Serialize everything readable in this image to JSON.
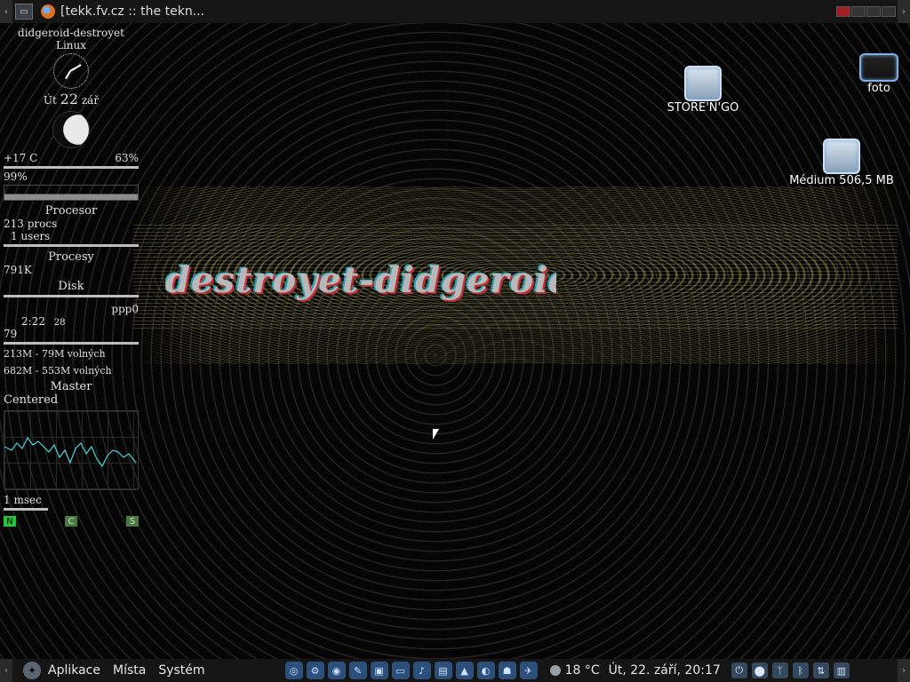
{
  "top_panel": {
    "left_arrow": "‹",
    "right_arrow": "›",
    "window_title": "[tekk.fv.cz :: the tekn...",
    "workspaces": [
      true,
      false,
      false,
      false
    ]
  },
  "conky": {
    "hostname": "didgeroid-destroyet",
    "os": "Linux",
    "date_day_name": "Út",
    "date_day": "22",
    "date_month": "zář",
    "temperature": "+17 C",
    "humidity": "63%",
    "cpu_percent": "99%",
    "processor_heading": "Procesor",
    "procs": "213 procs",
    "users": "1 users",
    "processes_heading": "Procesy",
    "mem_value": "791K",
    "disk_heading": "Disk",
    "net_interface": "ppp0",
    "uptime": "2:22",
    "uptime_extra": "28",
    "net_value": "79",
    "ram_line": "213M - 79M volných",
    "disk_line": "682M - 553M volných",
    "volume_label": "Master",
    "audio_mode": "Centered",
    "latency": "1 msec",
    "meter_labels": [
      "N",
      "C",
      "S"
    ]
  },
  "wallpaper": {
    "logo_text": "destroyet-didgeroid"
  },
  "desktop_icons": [
    {
      "label": "STORE'N'GO",
      "icon": "usb-drive-icon"
    },
    {
      "label": "foto",
      "icon": "folder-drive-icon"
    },
    {
      "label": "Médium 506,5 MB",
      "icon": "usb-drive-icon"
    }
  ],
  "bottom_panel": {
    "menu_applications": "Aplikace",
    "menu_places": "Místa",
    "menu_system": "Systém",
    "weather_temp": "18 °C",
    "clock": "Út, 22. září, 20:17",
    "launcher_icons": [
      "network-icon",
      "settings-icon",
      "photo-icon",
      "graphics-icon",
      "terminal-icon",
      "window-icon",
      "audio-icon",
      "archive-icon",
      "vlc-icon",
      "browser-icon",
      "game-icon",
      "bird-icon"
    ],
    "tray_icons": [
      "power-icon",
      "update-icon",
      "wireless-icon",
      "bluetooth-icon",
      "network-icon",
      "trash-icon"
    ]
  }
}
